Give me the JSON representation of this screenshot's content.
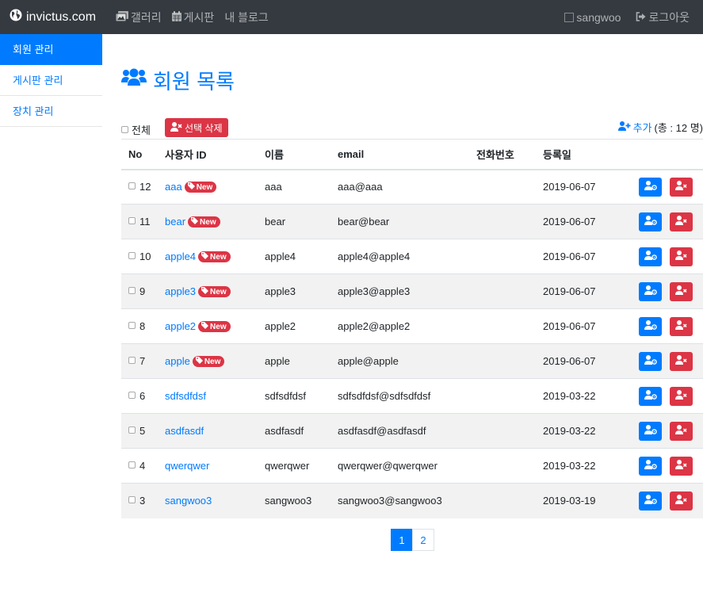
{
  "navbar": {
    "brand": "invictus.com",
    "links": [
      {
        "label": "갤러리",
        "icon": "image-icon"
      },
      {
        "label": "게시판",
        "icon": "calendar-icon"
      },
      {
        "label": "내 블로그",
        "icon": ""
      }
    ],
    "user": "sangwoo",
    "logout": "로그아웃"
  },
  "sidebar": {
    "items": [
      {
        "label": "회원 관리",
        "active": true
      },
      {
        "label": "게시판 관리",
        "active": false
      },
      {
        "label": "장치 관리",
        "active": false
      }
    ]
  },
  "main": {
    "title": "회원 목록",
    "select_all_label": "전체",
    "delete_selected_label": "선택 삭제",
    "add_label": "추가",
    "total_label": "(총 : 12 명)"
  },
  "table": {
    "headers": [
      "No",
      "사용자 ID",
      "이름",
      "email",
      "전화번호",
      "등록일"
    ],
    "badge_label": "New",
    "rows": [
      {
        "no": "12",
        "id": "aaa",
        "name": "aaa",
        "email": "aaa@aaa",
        "phone": "",
        "date": "2019-06-07",
        "is_new": true
      },
      {
        "no": "11",
        "id": "bear",
        "name": "bear",
        "email": "bear@bear",
        "phone": "",
        "date": "2019-06-07",
        "is_new": true
      },
      {
        "no": "10",
        "id": "apple4",
        "name": "apple4",
        "email": "apple4@apple4",
        "phone": "",
        "date": "2019-06-07",
        "is_new": true
      },
      {
        "no": "9",
        "id": "apple3",
        "name": "apple3",
        "email": "apple3@apple3",
        "phone": "",
        "date": "2019-06-07",
        "is_new": true
      },
      {
        "no": "8",
        "id": "apple2",
        "name": "apple2",
        "email": "apple2@apple2",
        "phone": "",
        "date": "2019-06-07",
        "is_new": true
      },
      {
        "no": "7",
        "id": "apple",
        "name": "apple",
        "email": "apple@apple",
        "phone": "",
        "date": "2019-06-07",
        "is_new": true
      },
      {
        "no": "6",
        "id": "sdfsdfdsf",
        "name": "sdfsdfdsf",
        "email": "sdfsdfdsf@sdfsdfdsf",
        "phone": "",
        "date": "2019-03-22",
        "is_new": false
      },
      {
        "no": "5",
        "id": "asdfasdf",
        "name": "asdfasdf",
        "email": "asdfasdf@asdfasdf",
        "phone": "",
        "date": "2019-03-22",
        "is_new": false
      },
      {
        "no": "4",
        "id": "qwerqwer",
        "name": "qwerqwer",
        "email": "qwerqwer@qwerqwer",
        "phone": "",
        "date": "2019-03-22",
        "is_new": false
      },
      {
        "no": "3",
        "id": "sangwoo3",
        "name": "sangwoo3",
        "email": "sangwoo3@sangwoo3",
        "phone": "",
        "date": "2019-03-19",
        "is_new": false
      }
    ]
  },
  "pagination": {
    "pages": [
      "1",
      "2"
    ],
    "active": "1"
  },
  "colors": {
    "primary": "#007bff",
    "danger": "#dc3545",
    "navbar": "#343a40"
  }
}
